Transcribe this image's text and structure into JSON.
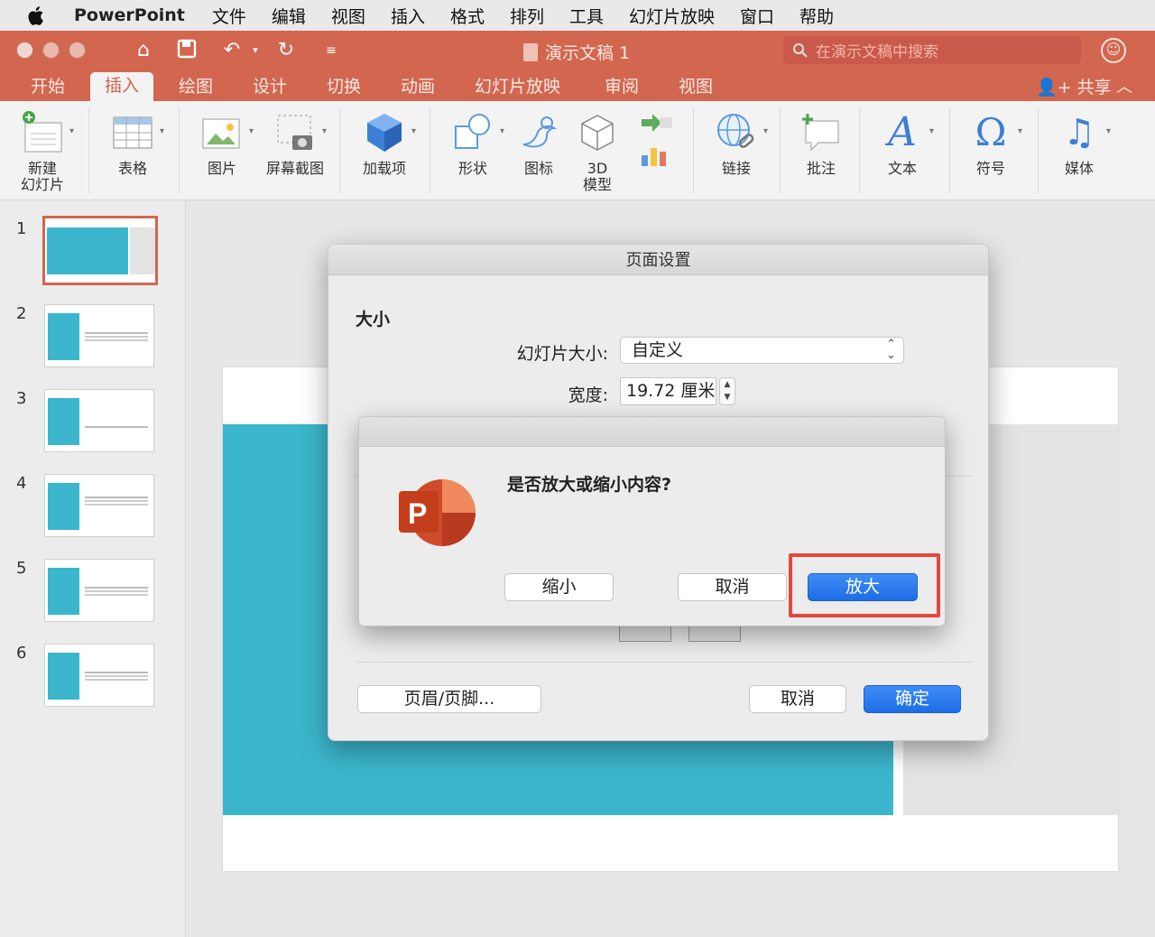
{
  "menubar": {
    "app_name": "PowerPoint",
    "items": [
      "文件",
      "编辑",
      "视图",
      "插入",
      "格式",
      "排列",
      "工具",
      "幻灯片放映",
      "窗口",
      "帮助"
    ]
  },
  "titlebar": {
    "doc_title": "演示文稿 1",
    "search_placeholder": "在演示文稿中搜索"
  },
  "tabs": {
    "items": [
      "开始",
      "插入",
      "绘图",
      "设计",
      "切换",
      "动画",
      "幻灯片放映",
      "审阅",
      "视图"
    ],
    "active": "插入",
    "share_label": "共享"
  },
  "ribbon": {
    "new_slide_1": "新建",
    "new_slide_2": "幻灯片",
    "table": "表格",
    "picture": "图片",
    "screenshot": "屏幕截图",
    "addins": "加载项",
    "shapes": "形状",
    "icons": "图标",
    "model_1": "3D",
    "model_2": "模型",
    "link": "链接",
    "comment": "批注",
    "text": "文本",
    "symbol": "符号",
    "media": "媒体"
  },
  "thumbnails": {
    "numbers": [
      "1",
      "2",
      "3",
      "4",
      "5",
      "6"
    ],
    "selected": "1"
  },
  "page_setup": {
    "title": "页面设置",
    "section_size": "大小",
    "slide_size_label": "幻灯片大小:",
    "slide_size_value": "自定义",
    "width_label": "宽度:",
    "width_value": "19.72 厘米",
    "header_footer_button": "页眉/页脚...",
    "cancel_button": "取消",
    "ok_button": "确定"
  },
  "alert": {
    "message": "是否放大或缩小内容?",
    "shrink_button": "缩小",
    "cancel_button": "取消",
    "maximize_button": "放大",
    "app_icon_letter": "P"
  },
  "colors": {
    "accent": "#d2664f",
    "slide_teal": "#3bb6cc",
    "button_blue": "#1d6de6",
    "highlight_red": "#e5473d"
  }
}
